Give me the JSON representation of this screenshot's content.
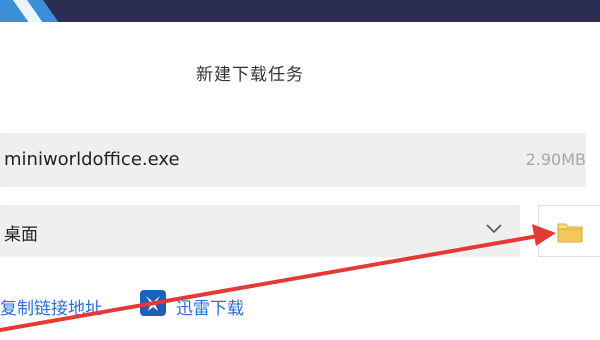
{
  "dialog": {
    "title": "新建下载任务",
    "file_name": "miniworldoffice.exe",
    "file_size": "2.90MB",
    "save_path": "桌面",
    "copy_link_label": "复制链接地址",
    "xunlei_label": "迅雷下载"
  },
  "icons": {
    "folder": "folder-icon",
    "chevron": "chevron-down-icon",
    "xunlei": "xunlei-logo-icon"
  },
  "colors": {
    "banner": "#2b2d52",
    "link": "#2a6fd6",
    "annotation_arrow": "#e53935",
    "folder": "#f2c75c"
  }
}
